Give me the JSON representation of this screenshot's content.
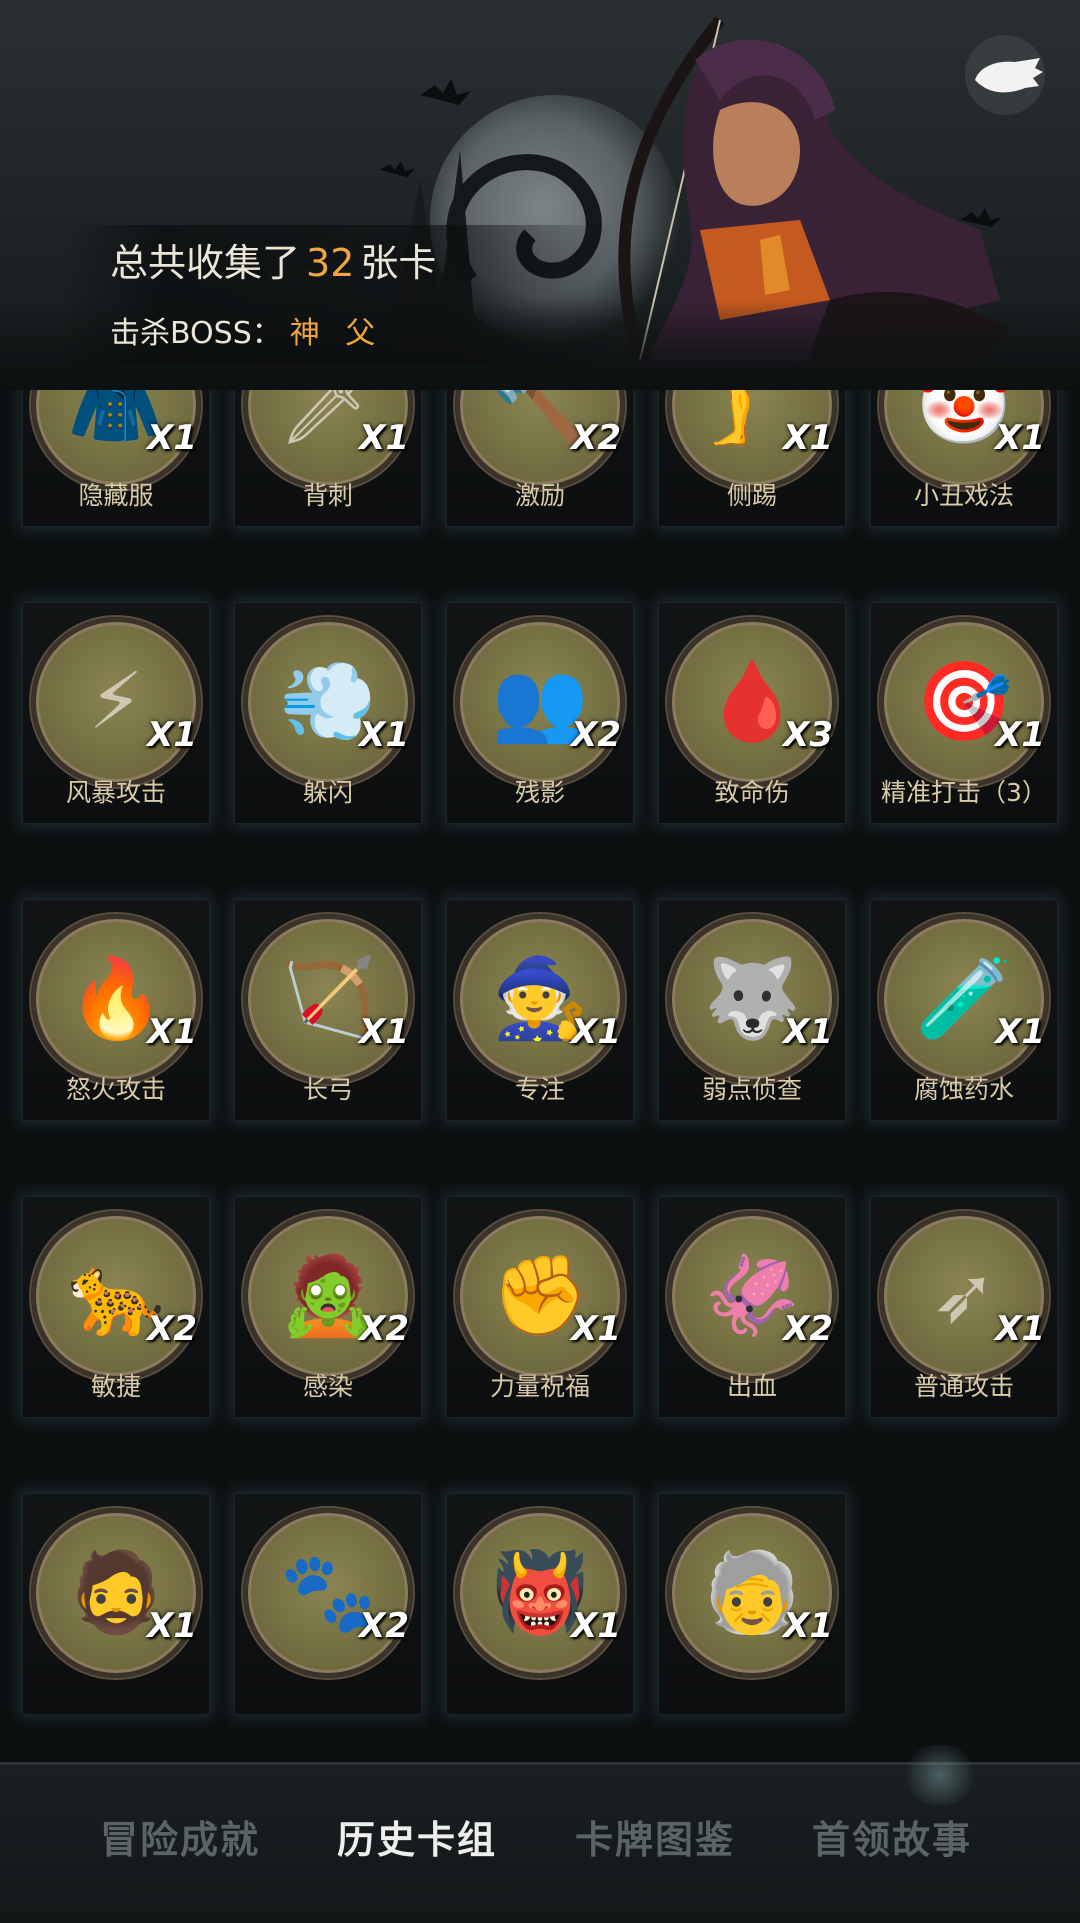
{
  "header": {
    "total_prefix": "总共收集了",
    "total_count": "32",
    "total_suffix": "张卡",
    "boss_label": "击杀BOSS：",
    "boss_name": "神 父"
  },
  "back_button": {
    "icon": "glove-back-icon"
  },
  "cards": [
    {
      "name": "隐藏服",
      "count": "X1",
      "icon": "hooded-cloak-icon"
    },
    {
      "name": "背刺",
      "count": "X1",
      "icon": "backstab-icon"
    },
    {
      "name": "激励",
      "count": "X2",
      "icon": "hammer-warrior-icon"
    },
    {
      "name": "侧踢",
      "count": "X1",
      "icon": "kick-icon"
    },
    {
      "name": "小丑戏法",
      "count": "X1",
      "icon": "clown-icon"
    },
    {
      "name": "风暴攻击",
      "count": "X1",
      "icon": "lightning-icon"
    },
    {
      "name": "躲闪",
      "count": "X1",
      "icon": "dodge-icon"
    },
    {
      "name": "残影",
      "count": "X2",
      "icon": "shadow-clones-icon"
    },
    {
      "name": "致命伤",
      "count": "X3",
      "icon": "dagger-blood-icon"
    },
    {
      "name": "精准打击（3）",
      "count": "X1",
      "icon": "target-icon"
    },
    {
      "name": "怒火攻击",
      "count": "X1",
      "icon": "fire-slash-icon"
    },
    {
      "name": "长弓",
      "count": "X1",
      "icon": "longbow-icon"
    },
    {
      "name": "专注",
      "count": "X1",
      "icon": "wizard-icon"
    },
    {
      "name": "弱点侦查",
      "count": "X1",
      "icon": "wolf-icon"
    },
    {
      "name": "腐蚀药水",
      "count": "X1",
      "icon": "potion-icon"
    },
    {
      "name": "敏捷",
      "count": "X2",
      "icon": "panther-icon"
    },
    {
      "name": "感染",
      "count": "X2",
      "icon": "infected-goblin-icon"
    },
    {
      "name": "力量祝福",
      "count": "X1",
      "icon": "fist-icon"
    },
    {
      "name": "出血",
      "count": "X2",
      "icon": "bleeding-creature-icon"
    },
    {
      "name": "普通攻击",
      "count": "X1",
      "icon": "arrow-strike-icon"
    },
    {
      "name": "",
      "count": "X1",
      "icon": "bearded-warrior-icon"
    },
    {
      "name": "",
      "count": "X2",
      "icon": "werewolf-icon"
    },
    {
      "name": "",
      "count": "X1",
      "icon": "troll-face-icon"
    },
    {
      "name": "",
      "count": "X1",
      "icon": "old-priest-icon"
    }
  ],
  "tabs": [
    {
      "label": "冒险成就",
      "active": false
    },
    {
      "label": "历史卡组",
      "active": true
    },
    {
      "label": "卡牌图鉴",
      "active": false
    },
    {
      "label": "首领故事",
      "active": false
    }
  ],
  "colors": {
    "accent": "#f0a640",
    "card_glow": "#46787380",
    "medal": "#7a7546"
  }
}
